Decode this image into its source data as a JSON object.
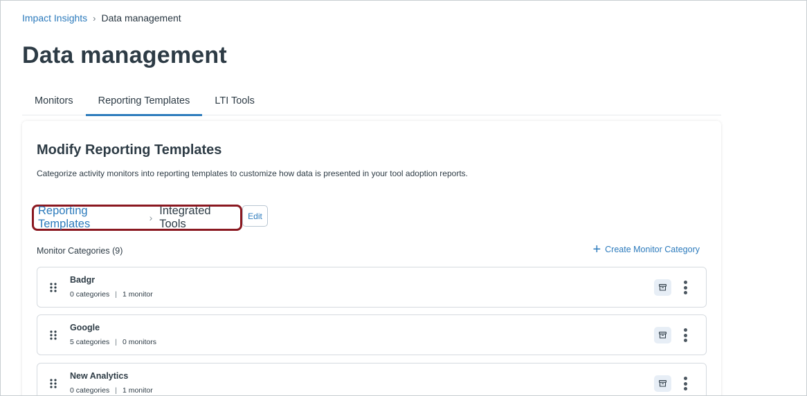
{
  "breadcrumb": {
    "root": "Impact Insights",
    "separator": "›",
    "current": "Data management"
  },
  "page": {
    "title": "Data management"
  },
  "tabs": [
    {
      "label": "Monitors",
      "active": false
    },
    {
      "label": "Reporting Templates",
      "active": true
    },
    {
      "label": "LTI Tools",
      "active": false
    }
  ],
  "card": {
    "title": "Modify Reporting Templates",
    "description": "Categorize activity monitors into reporting templates to customize how data is presented in your tool adoption reports.",
    "template_breadcrumb": {
      "root": "Reporting Templates",
      "separator": "›",
      "current": "Integrated Tools"
    },
    "edit_label": "Edit",
    "categories_heading": "Monitor Categories (9)",
    "create_label": "Create Monitor Category",
    "create_icon": "plus-icon",
    "rows": [
      {
        "title": "Badgr",
        "categories": "0 categories",
        "monitors": "1 monitor"
      },
      {
        "title": "Google",
        "categories": "5 categories",
        "monitors": "0 monitors"
      },
      {
        "title": "New Analytics",
        "categories": "0 categories",
        "monitors": "1 monitor"
      }
    ],
    "row_separator": "|"
  },
  "colors": {
    "link": "#2b7abc",
    "highlight_border": "#8a1820",
    "archive_bg": "#e7eef6"
  },
  "icons": [
    "drag-handle-icon",
    "archive-icon",
    "kebab-menu-icon",
    "chevron-right-icon",
    "plus-icon"
  ]
}
